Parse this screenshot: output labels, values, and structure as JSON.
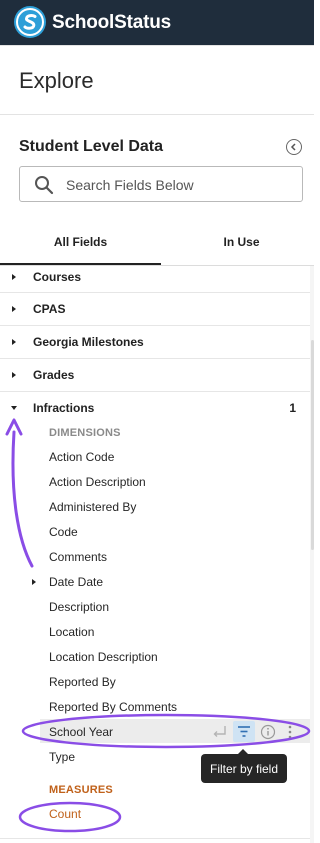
{
  "header": {
    "brand": "SchoolStatus",
    "logo_icon": "schoolstatus-logo-icon",
    "bg_color": "#1f2d3c",
    "logo_color": "#2d9fd8"
  },
  "page_title": "Explore",
  "explore": {
    "model_name": "Student Level Data",
    "search_placeholder": "Search Fields Below",
    "tabs": [
      {
        "label": "All Fields",
        "active": true
      },
      {
        "label": "In Use",
        "active": false
      }
    ]
  },
  "groups": [
    {
      "label": "Courses",
      "expanded": false
    },
    {
      "label": "CPAS",
      "expanded": false
    },
    {
      "label": "Georgia Milestones",
      "expanded": false
    },
    {
      "label": "Grades",
      "expanded": false
    },
    {
      "label": "Infractions",
      "expanded": true,
      "count": "1"
    }
  ],
  "infractions": {
    "dimensions_label": "DIMENSIONS",
    "fields": [
      {
        "label": "Action Code"
      },
      {
        "label": "Action Description"
      },
      {
        "label": "Administered By"
      },
      {
        "label": "Code"
      },
      {
        "label": "Comments"
      },
      {
        "label": "Date Date",
        "has_children": true
      },
      {
        "label": "Description"
      },
      {
        "label": "Location"
      },
      {
        "label": "Location Description"
      },
      {
        "label": "Reported By"
      },
      {
        "label": "Reported By Comments"
      },
      {
        "label": "School Year",
        "hovered": true
      },
      {
        "label": "Type"
      }
    ],
    "measures_label": "MEASURES",
    "measures": [
      {
        "label": "Count"
      }
    ]
  },
  "tooltip": {
    "text": "Filter by field"
  },
  "colors": {
    "dimension_label": "#8a8a8a",
    "measure_label": "#c0611a",
    "measure_field": "#c0611a",
    "annotation": "#8a4de6",
    "filter_active_bg": "#cfe3f4"
  }
}
